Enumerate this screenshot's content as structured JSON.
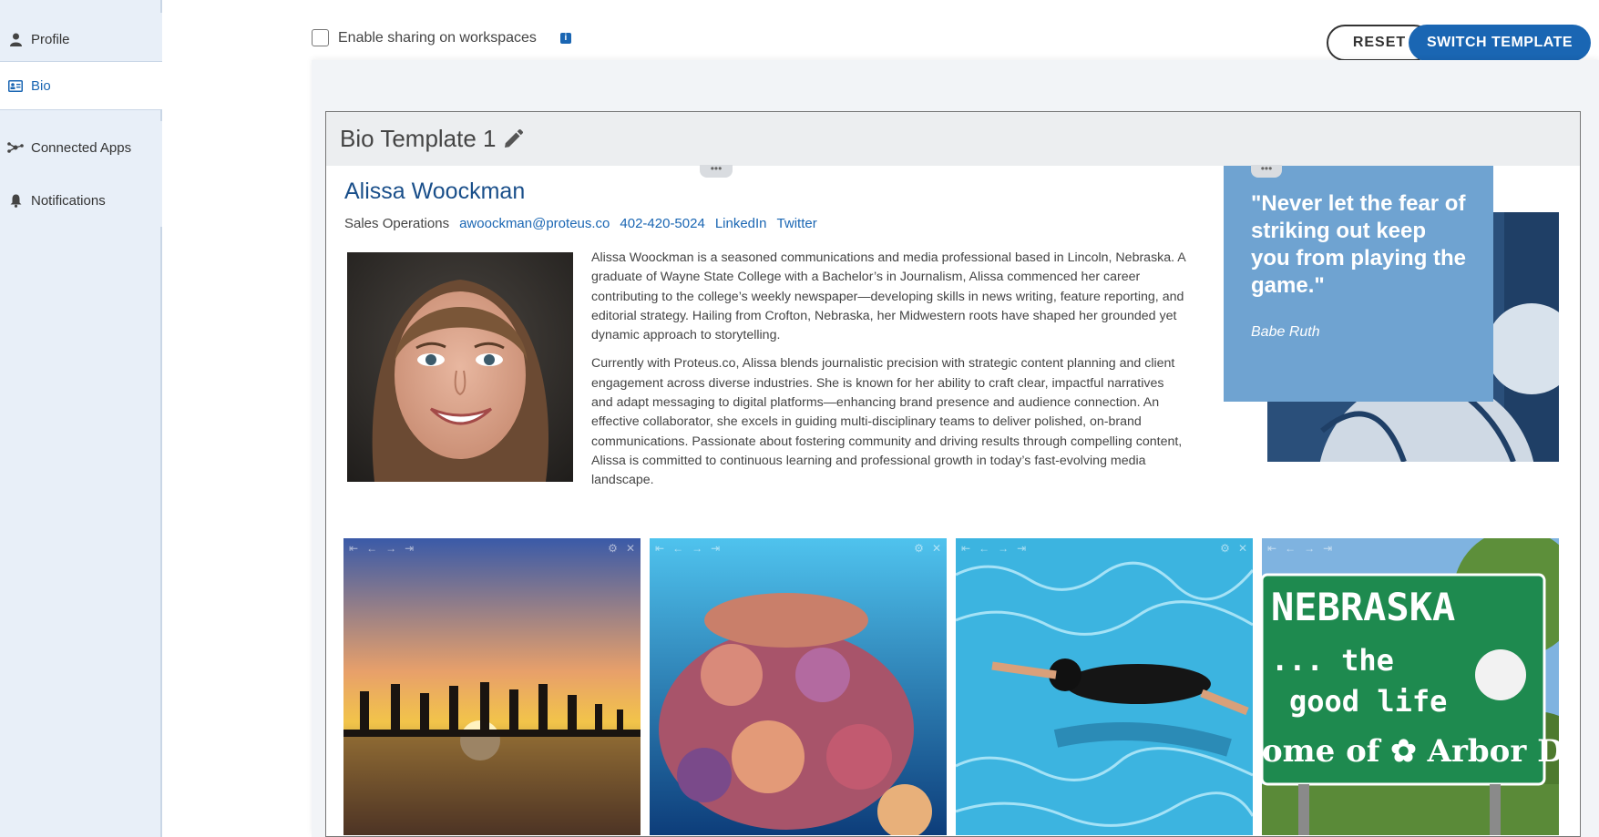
{
  "sidebar": {
    "items": [
      {
        "label": "Profile",
        "icon": "user-icon",
        "active": false
      },
      {
        "label": "Bio",
        "icon": "id-card-icon",
        "active": true
      },
      {
        "label": "Connected Apps",
        "icon": "network-icon",
        "active": false
      },
      {
        "label": "Notifications",
        "icon": "bell-icon",
        "active": false
      }
    ]
  },
  "toolbar": {
    "share_label": "Enable sharing on workspaces",
    "share_checked": false,
    "info_icon": "info-icon",
    "reset_label": "RESET",
    "switch_label": "SWITCH TEMPLATE"
  },
  "template": {
    "title": "Bio Template 1",
    "handle_glyph": "•••",
    "name": "Alissa Woockman",
    "role": "Sales Operations",
    "email": "awoockman@proteus.co",
    "phone": "402-420-5024",
    "linkedin": "LinkedIn",
    "twitter": "Twitter",
    "bio_paragraphs": [
      "Alissa Woockman is a seasoned communications and media professional based in Lincoln, Nebraska. A graduate of Wayne State College with a Bachelor’s in Journalism, Alissa commenced her career contributing to the college’s weekly newspaper—developing skills in news writing, feature reporting, and editorial strategy. Hailing from Crofton, Nebraska, her Midwestern roots have shaped her grounded yet dynamic approach to storytelling.",
      "Currently with Proteus.co, Alissa blends journalistic precision with strategic content planning and client engagement across diverse industries. She is known for her ability to craft clear, impactful narratives and adapt messaging to digital platforms—enhancing brand presence and audience connection. An effective collaborator, she excels in guiding multi-disciplinary teams to deliver polished, on-brand communications. Passionate about fostering community and driving results through compelling content, Alissa is committed to continuous learning and professional growth in today’s fast-evolving media landscape."
    ],
    "quote": {
      "text": "\"Never let the fear of striking out keep you from playing the game.\"",
      "author": "Babe Ruth"
    },
    "sign_lines": [
      "NEBRASKA",
      "... the",
      "good life",
      "ome of ✿ Arbor Da"
    ]
  },
  "colors": {
    "accent": "#1a66b3",
    "sidebar_bg": "#e8eff8",
    "quote_bg": "#6fa3d1",
    "header_bg": "#eceef0"
  }
}
